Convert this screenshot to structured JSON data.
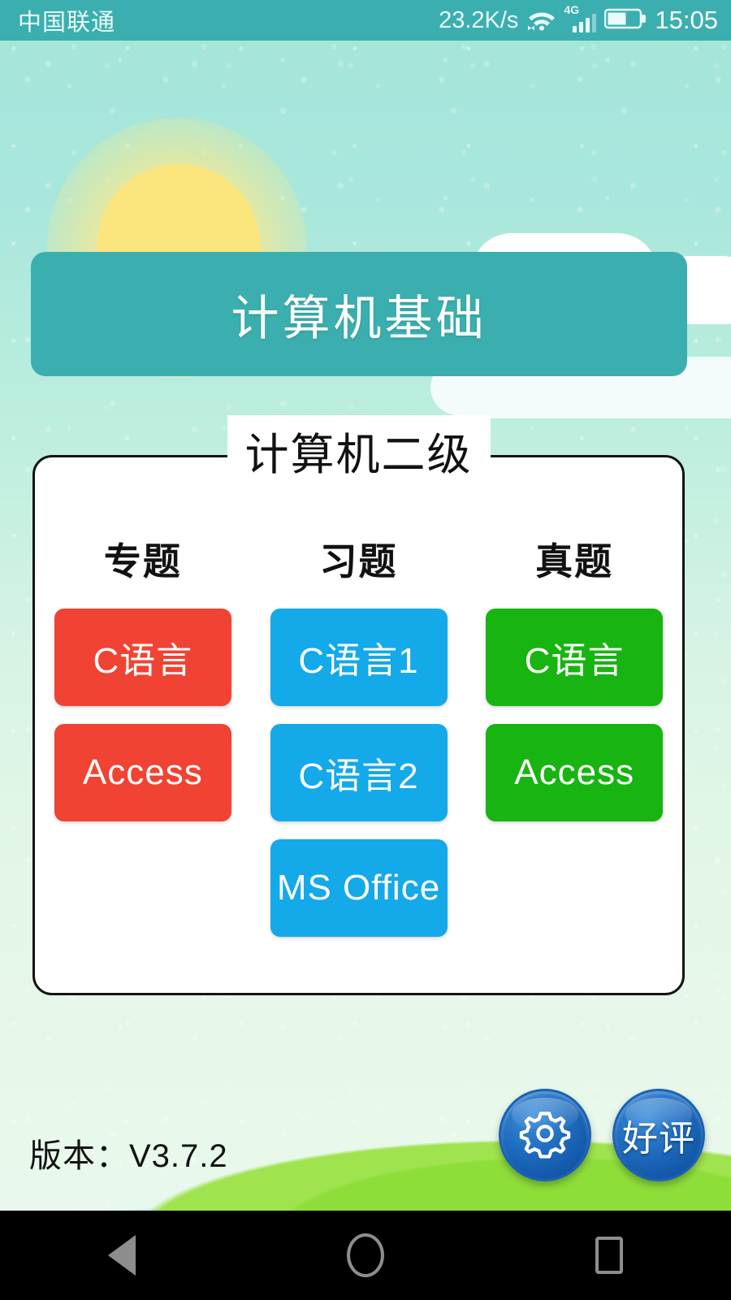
{
  "status_bar": {
    "carrier": "中国联通",
    "net_speed": "23.2K/s",
    "network_type": "4G",
    "clock": "15:05",
    "icons": [
      "wifi-icon",
      "signal-bars-icon",
      "battery-icon"
    ],
    "background_color": "#3BAFAF"
  },
  "header": {
    "title": "计算机基础",
    "background_color": "#3BAFAF",
    "text_color": "#FFFFFF"
  },
  "card": {
    "badge": "计算机二级",
    "column_headers": [
      "专题",
      "习题",
      "真题"
    ],
    "rows": [
      [
        {
          "label": "C语言",
          "color": "#F04333",
          "column": "专题"
        },
        {
          "label": "C语言1",
          "color": "#14A9E8",
          "column": "习题"
        },
        {
          "label": "C语言",
          "color": "#18B411",
          "column": "真题"
        }
      ],
      [
        {
          "label": "Access",
          "color": "#F04333",
          "column": "专题"
        },
        {
          "label": "C语言2",
          "color": "#14A9E8",
          "column": "习题"
        },
        {
          "label": "Access",
          "color": "#18B411",
          "column": "真题"
        }
      ],
      [
        {
          "label": "",
          "color": "",
          "column": "专题",
          "empty": true
        },
        {
          "label": "MS Office",
          "color": "#14A9E8",
          "column": "习题"
        },
        {
          "label": "",
          "color": "",
          "column": "真题",
          "empty": true
        }
      ]
    ]
  },
  "footer": {
    "version": "版本：V3.7.2",
    "settings_icon": "gear-icon",
    "rate_label": "好评",
    "round_button_color": "#1459AB"
  },
  "nav_bar": {
    "back": "back-triangle-icon",
    "home": "home-circle-icon",
    "recents": "recents-square-icon",
    "background_color": "#000000"
  },
  "background": {
    "sky_color": "#A5E6D8",
    "sun_color": "#FBE67E",
    "cloud_color": "#FFFFFF",
    "hill_color": "#9FE34F",
    "stream_color": "#BFE9F6"
  }
}
